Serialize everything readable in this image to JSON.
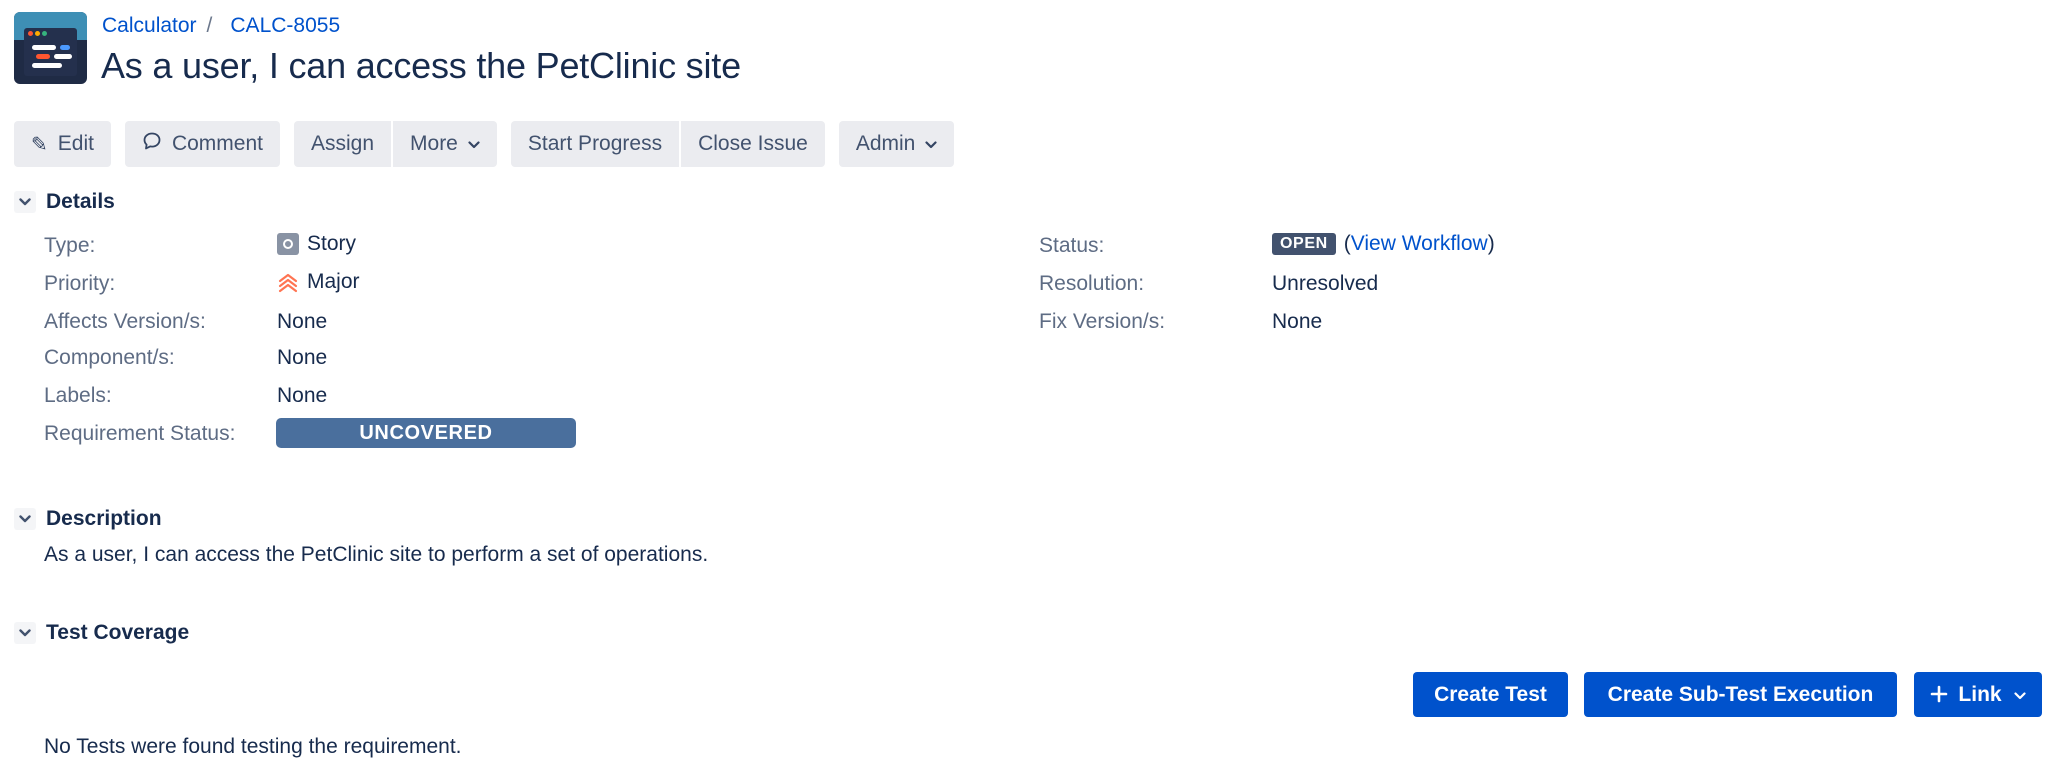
{
  "breadcrumb": {
    "project": "Calculator",
    "separator": "/",
    "issue_key": "CALC-8055"
  },
  "issue": {
    "title": "As a user, I can access the PetClinic site"
  },
  "toolbar": {
    "edit": "Edit",
    "comment": "Comment",
    "assign": "Assign",
    "more": "More",
    "start_progress": "Start Progress",
    "close_issue": "Close Issue",
    "admin": "Admin"
  },
  "details": {
    "heading": "Details",
    "type_label": "Type:",
    "type_value": "Story",
    "priority_label": "Priority:",
    "priority_value": "Major",
    "affects_label": "Affects Version/s:",
    "affects_value": "None",
    "components_label": "Component/s:",
    "components_value": "None",
    "labels_label": "Labels:",
    "labels_value": "None",
    "req_status_label": "Requirement Status:",
    "req_status_value": "UNCOVERED",
    "status_label": "Status:",
    "status_value": "OPEN",
    "view_workflow_open": "(",
    "view_workflow": "View Workflow",
    "view_workflow_close": ")",
    "resolution_label": "Resolution:",
    "resolution_value": "Unresolved",
    "fix_label": "Fix Version/s:",
    "fix_value": "None"
  },
  "description": {
    "heading": "Description",
    "text": "As a user, I can access the PetClinic site to perform a set of operations."
  },
  "test_coverage": {
    "heading": "Test Coverage",
    "create_test": "Create Test",
    "create_sub_test_execution": "Create Sub-Test Execution",
    "link": "Link",
    "empty_message": "No Tests were found testing the requirement."
  },
  "colors": {
    "link": "#0052cc",
    "primary_button": "#0052cc",
    "status_lozenge": "#42526e",
    "uncovered_badge": "#4a6f9d",
    "priority_major": "#ff7452"
  },
  "icons": {
    "edit": "pencil-icon",
    "comment": "speech-bubble-icon",
    "dropdown": "chevron-down-icon",
    "section_toggle": "chevron-down-icon",
    "type": "story-icon",
    "priority": "priority-major-icon",
    "add": "plus-icon"
  }
}
